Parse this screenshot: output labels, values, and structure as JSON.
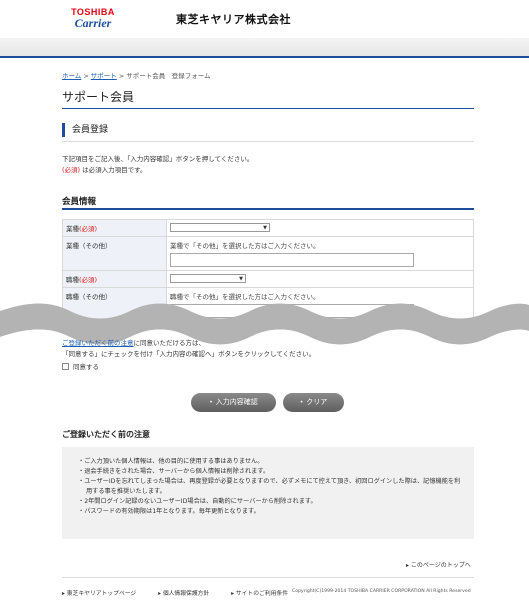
{
  "header": {
    "logo_top": "TOSHIBA",
    "logo_bottom": "Carrier",
    "company": "東芝キヤリア株式会社"
  },
  "breadcrumb": [
    "ホーム",
    "サポート",
    "サポート会員　登録フォーム"
  ],
  "page_title": "サポート会員",
  "section_title": "会員登録",
  "intro": {
    "line1": "下記項目をご記入後、「入力内容確認」ボタンを押してください。",
    "req_mark": "(必須)",
    "line2_rest": " は必須入力項目です。"
  },
  "sub_title": "会員情報",
  "form": {
    "rows": [
      {
        "label": "業種",
        "required": "(必須)"
      },
      {
        "label": "業種（その他）",
        "hint": "業種で「その他」を選択した方はご入力ください。"
      },
      {
        "label": "職種",
        "required": "(必須)"
      },
      {
        "label": "職種（その他）",
        "hint": "職種で「その他」を選択した方はご入力ください。"
      }
    ]
  },
  "agree": {
    "line1_link": "ご登録いただく前の注意",
    "line1_rest": "に同意いただける方は、",
    "line2": "「同意する」にチェックを付け「入力内容の確認へ」ボタンをクリックしてください。",
    "checkbox_label": "同意する"
  },
  "buttons": {
    "confirm": "入力内容確認",
    "clear": "クリア"
  },
  "notice": {
    "title": "ご登録いただく前の注意",
    "items": [
      "ご入力頂いた個人情報は、他の目的に使用する事はありません。",
      "退会手続きをされた場合、サーバーから個人情報は削除されます。",
      "ユーザーIDを忘れてしまった場合は、再度登録が必要となりますので、必ずメモにて控えて頂き、初回ログインした際は、記憶機能を利用する事を推奨いたします。",
      "2年間ログイン記録のないユーザーID場合は、自動的にサーバーから削除されます。",
      "パスワードの有効期限は1年となります。毎年更新となります。"
    ]
  },
  "pagetop": "このページのトップへ",
  "footer": {
    "links": [
      "東芝キヤリアトップページ",
      "個人情報保護方針",
      "サイトのご利用条件"
    ],
    "copyright": "Copyright(C)1999-2014 TOSHIBA CARRIER CORPORATION All Rights Reserved"
  },
  "colors": {
    "accent": "#1d4e9c",
    "required": "#d61a1a",
    "brand_red": "#e60012"
  }
}
